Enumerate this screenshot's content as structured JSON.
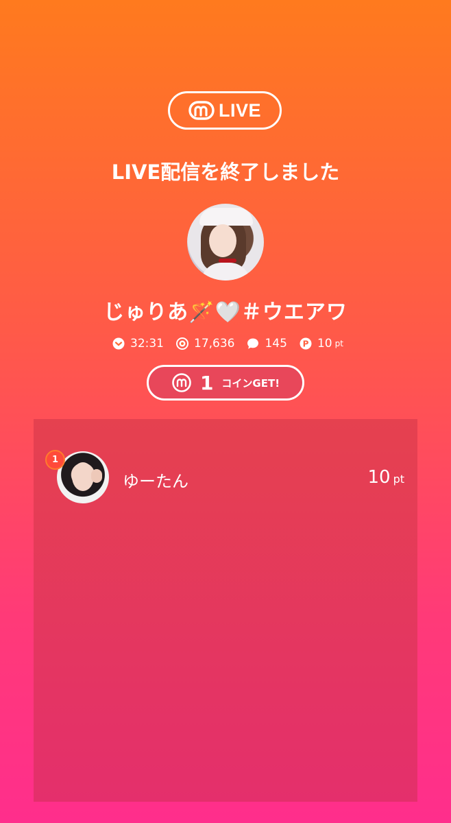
{
  "header": {
    "logo_icon": "m-logo-icon",
    "logo_text": "LIVE",
    "title": "LIVE配信を終了しました"
  },
  "streamer": {
    "avatar": "streamer-avatar",
    "name": "じゅりあ🪄🤍＃ウエアワ"
  },
  "stats": {
    "duration_icon": "chevron-down-icon",
    "duration": "32:31",
    "viewers_icon": "viewers-icon",
    "viewers": "17,636",
    "comments_icon": "comment-bubble-icon",
    "comments": "145",
    "points_icon": "p-badge-icon",
    "points": "10",
    "points_unit": "pt"
  },
  "coin": {
    "icon": "m-coin-icon",
    "amount": "1",
    "label": "コインGET!"
  },
  "ranking": [
    {
      "rank": "1",
      "name": "ゆーたん",
      "points": "10",
      "unit": "pt"
    }
  ],
  "colors": {
    "accent_top": "#ff7a1e",
    "accent_bottom": "#ff2e8c",
    "panel": "#e5414f"
  }
}
